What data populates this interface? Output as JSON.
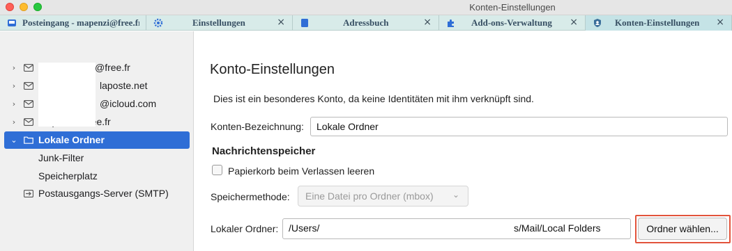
{
  "window": {
    "title": "Konten-Einstellungen"
  },
  "tabs": [
    {
      "label": "Posteingang - mapenzi@free.fr",
      "icon": "inbox-icon",
      "closable": false
    },
    {
      "label": "Einstellungen",
      "icon": "gear-icon",
      "closable": true
    },
    {
      "label": "Adressbuch",
      "icon": "address-book-icon",
      "closable": true
    },
    {
      "label": "Add-ons-Verwaltung",
      "icon": "puzzle-icon",
      "closable": true
    },
    {
      "label": "Konten-Einstellungen",
      "icon": "shield-account-icon",
      "closable": true,
      "active": true
    }
  ],
  "tab_close_glyph": "×",
  "sidebar": {
    "accounts": [
      {
        "label": "@free.fr",
        "expanded": false
      },
      {
        "label": "laposte.net",
        "expanded": false
      },
      {
        "label": "@icloud.com",
        "expanded": false
      },
      {
        "label": "mapenzi@free.fr",
        "expanded": false
      },
      {
        "label": "Lokale Ordner",
        "expanded": true,
        "selected": true
      }
    ],
    "sub_items": [
      "Junk-Filter",
      "Speicherplatz"
    ],
    "smtp": "Postausgangs-Server (SMTP)",
    "twisty_collapsed": "›",
    "twisty_expanded": "⌄"
  },
  "content": {
    "title": "Konto-Einstellungen",
    "info": "Dies ist ein besonderes Konto, da keine Identitäten mit ihm verknüpft sind.",
    "account_name_label": "Konten-Bezeichnung:",
    "account_name_value": "Lokale Ordner",
    "section_title": "Nachrichtenspeicher",
    "empty_trash_label": "Papierkorb beim Verlassen leeren",
    "empty_trash_checked": false,
    "storage_method_label": "Speichermethode:",
    "storage_method_value": "Eine Datei pro Ordner (mbox)",
    "local_folder_label": "Lokaler Ordner:",
    "local_folder_prefix": "/Users/",
    "local_folder_suffix": "s/Mail/Local Folders",
    "choose_folder_button": "Ordner wählen..."
  },
  "colors": {
    "accent_selected": "#2f6ed6",
    "highlight_border": "#e2533b",
    "tabbar_bg": "#d8ebe9"
  }
}
